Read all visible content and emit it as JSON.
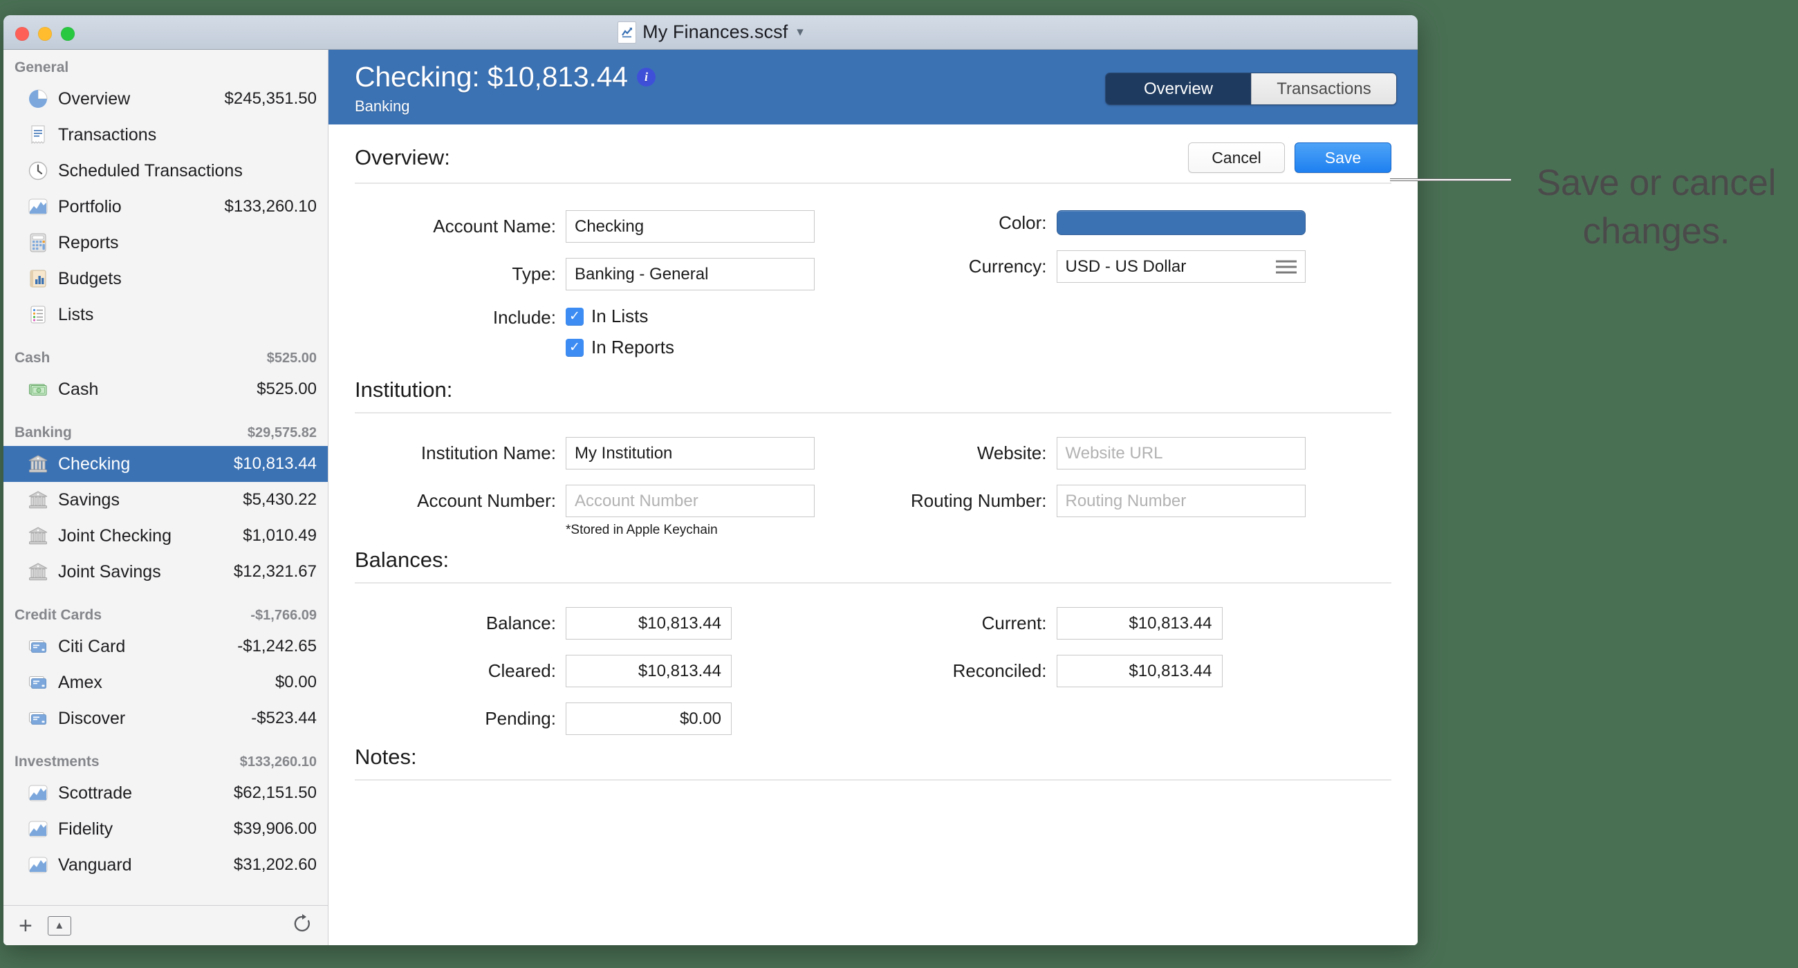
{
  "window": {
    "title": "My Finances.scsf",
    "title_chevron": "chevron-down",
    "traffic_lights": [
      "close",
      "minimize",
      "zoom"
    ]
  },
  "sidebar": {
    "groups": [
      {
        "name": "General",
        "amount": "",
        "items": [
          {
            "label": "Overview",
            "amount": "$245,351.50",
            "icon": "pie-chart-icon",
            "selected": false
          },
          {
            "label": "Transactions",
            "amount": "",
            "icon": "receipt-icon",
            "selected": false
          },
          {
            "label": "Scheduled Transactions",
            "amount": "",
            "icon": "clock-icon",
            "selected": false
          },
          {
            "label": "Portfolio",
            "amount": "$133,260.10",
            "icon": "chart-area-icon",
            "selected": false
          },
          {
            "label": "Reports",
            "amount": "",
            "icon": "calculator-icon",
            "selected": false
          },
          {
            "label": "Budgets",
            "amount": "",
            "icon": "bar-chart-icon",
            "selected": false
          },
          {
            "label": "Lists",
            "amount": "",
            "icon": "list-icon",
            "selected": false
          }
        ]
      },
      {
        "name": "Cash",
        "amount": "$525.00",
        "items": [
          {
            "label": "Cash",
            "amount": "$525.00",
            "icon": "banknote-icon",
            "selected": false
          }
        ]
      },
      {
        "name": "Banking",
        "amount": "$29,575.82",
        "items": [
          {
            "label": "Checking",
            "amount": "$10,813.44",
            "icon": "bank-icon",
            "selected": true
          },
          {
            "label": "Savings",
            "amount": "$5,430.22",
            "icon": "bank-icon",
            "selected": false
          },
          {
            "label": "Joint Checking",
            "amount": "$1,010.49",
            "icon": "bank-icon",
            "selected": false
          },
          {
            "label": "Joint Savings",
            "amount": "$12,321.67",
            "icon": "bank-icon",
            "selected": false
          }
        ]
      },
      {
        "name": "Credit Cards",
        "amount": "-$1,766.09",
        "items": [
          {
            "label": "Citi Card",
            "amount": "-$1,242.65",
            "icon": "credit-card-icon",
            "selected": false
          },
          {
            "label": "Amex",
            "amount": "$0.00",
            "icon": "credit-card-icon",
            "selected": false
          },
          {
            "label": "Discover",
            "amount": "-$523.44",
            "icon": "credit-card-icon",
            "selected": false
          }
        ]
      },
      {
        "name": "Investments",
        "amount": "$133,260.10",
        "items": [
          {
            "label": "Scottrade",
            "amount": "$62,151.50",
            "icon": "chart-area-icon",
            "selected": false
          },
          {
            "label": "Fidelity",
            "amount": "$39,906.00",
            "icon": "chart-area-icon",
            "selected": false
          },
          {
            "label": "Vanguard",
            "amount": "$31,202.60",
            "icon": "chart-area-icon",
            "selected": false
          }
        ]
      }
    ],
    "footer": {
      "add": "plus-icon",
      "collapse": "chevron-up-box-icon",
      "refresh": "refresh-icon"
    }
  },
  "detail": {
    "header": {
      "title": "Checking: $10,813.44",
      "info_badge": "i",
      "subtitle": "Banking",
      "tabs": [
        {
          "label": "Overview",
          "active": true
        },
        {
          "label": "Transactions",
          "active": false
        }
      ]
    },
    "sections": {
      "overview": {
        "title": "Overview:",
        "cancel_label": "Cancel",
        "save_label": "Save",
        "fields": {
          "account_name_label": "Account Name:",
          "account_name_value": "Checking",
          "type_label": "Type:",
          "type_value": "Banking - General",
          "include_label": "Include:",
          "include_in_lists": "In Lists",
          "include_in_reports": "In Reports",
          "color_label": "Color:",
          "color_value": "#3b72b4",
          "currency_label": "Currency:",
          "currency_value": "USD - US Dollar"
        }
      },
      "institution": {
        "title": "Institution:",
        "fields": {
          "institution_name_label": "Institution Name:",
          "institution_name_value": "My Institution",
          "account_number_label": "Account Number:",
          "account_number_placeholder": "Account Number",
          "website_label": "Website:",
          "website_placeholder": "Website URL",
          "routing_number_label": "Routing Number:",
          "routing_number_placeholder": "Routing Number",
          "keychain_note": "*Stored in Apple Keychain"
        }
      },
      "balances": {
        "title": "Balances:",
        "fields": {
          "balance_label": "Balance:",
          "balance_value": "$10,813.44",
          "cleared_label": "Cleared:",
          "cleared_value": "$10,813.44",
          "pending_label": "Pending:",
          "pending_value": "$0.00",
          "current_label": "Current:",
          "current_value": "$10,813.44",
          "reconciled_label": "Reconciled:",
          "reconciled_value": "$10,813.44"
        }
      },
      "notes": {
        "title": "Notes:"
      }
    }
  },
  "annotation": {
    "text": "Save or cancel changes."
  },
  "colors": {
    "accent_blue": "#3b72b4",
    "save_blue": "#1e80f0",
    "tab_active": "#1e3a5f",
    "backdrop_green": "#4a7054"
  }
}
